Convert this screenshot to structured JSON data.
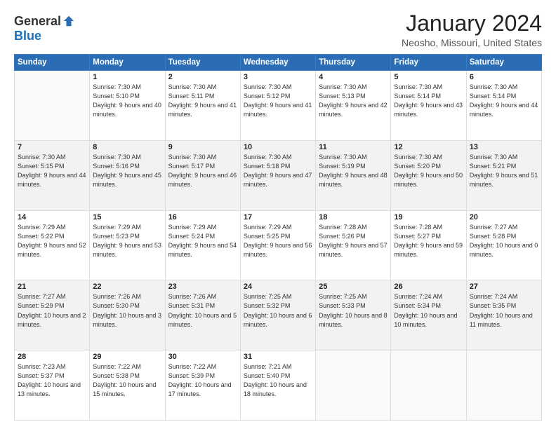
{
  "header": {
    "logo": {
      "general": "General",
      "blue": "Blue"
    },
    "title": "January 2024",
    "location": "Neosho, Missouri, United States"
  },
  "weekdays": [
    "Sunday",
    "Monday",
    "Tuesday",
    "Wednesday",
    "Thursday",
    "Friday",
    "Saturday"
  ],
  "weeks": [
    [
      {
        "day": "",
        "sunrise": "",
        "sunset": "",
        "daylight": ""
      },
      {
        "day": "1",
        "sunrise": "Sunrise: 7:30 AM",
        "sunset": "Sunset: 5:10 PM",
        "daylight": "Daylight: 9 hours and 40 minutes."
      },
      {
        "day": "2",
        "sunrise": "Sunrise: 7:30 AM",
        "sunset": "Sunset: 5:11 PM",
        "daylight": "Daylight: 9 hours and 41 minutes."
      },
      {
        "day": "3",
        "sunrise": "Sunrise: 7:30 AM",
        "sunset": "Sunset: 5:12 PM",
        "daylight": "Daylight: 9 hours and 41 minutes."
      },
      {
        "day": "4",
        "sunrise": "Sunrise: 7:30 AM",
        "sunset": "Sunset: 5:13 PM",
        "daylight": "Daylight: 9 hours and 42 minutes."
      },
      {
        "day": "5",
        "sunrise": "Sunrise: 7:30 AM",
        "sunset": "Sunset: 5:14 PM",
        "daylight": "Daylight: 9 hours and 43 minutes."
      },
      {
        "day": "6",
        "sunrise": "Sunrise: 7:30 AM",
        "sunset": "Sunset: 5:14 PM",
        "daylight": "Daylight: 9 hours and 44 minutes."
      }
    ],
    [
      {
        "day": "7",
        "sunrise": "Sunrise: 7:30 AM",
        "sunset": "Sunset: 5:15 PM",
        "daylight": "Daylight: 9 hours and 44 minutes."
      },
      {
        "day": "8",
        "sunrise": "Sunrise: 7:30 AM",
        "sunset": "Sunset: 5:16 PM",
        "daylight": "Daylight: 9 hours and 45 minutes."
      },
      {
        "day": "9",
        "sunrise": "Sunrise: 7:30 AM",
        "sunset": "Sunset: 5:17 PM",
        "daylight": "Daylight: 9 hours and 46 minutes."
      },
      {
        "day": "10",
        "sunrise": "Sunrise: 7:30 AM",
        "sunset": "Sunset: 5:18 PM",
        "daylight": "Daylight: 9 hours and 47 minutes."
      },
      {
        "day": "11",
        "sunrise": "Sunrise: 7:30 AM",
        "sunset": "Sunset: 5:19 PM",
        "daylight": "Daylight: 9 hours and 48 minutes."
      },
      {
        "day": "12",
        "sunrise": "Sunrise: 7:30 AM",
        "sunset": "Sunset: 5:20 PM",
        "daylight": "Daylight: 9 hours and 50 minutes."
      },
      {
        "day": "13",
        "sunrise": "Sunrise: 7:30 AM",
        "sunset": "Sunset: 5:21 PM",
        "daylight": "Daylight: 9 hours and 51 minutes."
      }
    ],
    [
      {
        "day": "14",
        "sunrise": "Sunrise: 7:29 AM",
        "sunset": "Sunset: 5:22 PM",
        "daylight": "Daylight: 9 hours and 52 minutes."
      },
      {
        "day": "15",
        "sunrise": "Sunrise: 7:29 AM",
        "sunset": "Sunset: 5:23 PM",
        "daylight": "Daylight: 9 hours and 53 minutes."
      },
      {
        "day": "16",
        "sunrise": "Sunrise: 7:29 AM",
        "sunset": "Sunset: 5:24 PM",
        "daylight": "Daylight: 9 hours and 54 minutes."
      },
      {
        "day": "17",
        "sunrise": "Sunrise: 7:29 AM",
        "sunset": "Sunset: 5:25 PM",
        "daylight": "Daylight: 9 hours and 56 minutes."
      },
      {
        "day": "18",
        "sunrise": "Sunrise: 7:28 AM",
        "sunset": "Sunset: 5:26 PM",
        "daylight": "Daylight: 9 hours and 57 minutes."
      },
      {
        "day": "19",
        "sunrise": "Sunrise: 7:28 AM",
        "sunset": "Sunset: 5:27 PM",
        "daylight": "Daylight: 9 hours and 59 minutes."
      },
      {
        "day": "20",
        "sunrise": "Sunrise: 7:27 AM",
        "sunset": "Sunset: 5:28 PM",
        "daylight": "Daylight: 10 hours and 0 minutes."
      }
    ],
    [
      {
        "day": "21",
        "sunrise": "Sunrise: 7:27 AM",
        "sunset": "Sunset: 5:29 PM",
        "daylight": "Daylight: 10 hours and 2 minutes."
      },
      {
        "day": "22",
        "sunrise": "Sunrise: 7:26 AM",
        "sunset": "Sunset: 5:30 PM",
        "daylight": "Daylight: 10 hours and 3 minutes."
      },
      {
        "day": "23",
        "sunrise": "Sunrise: 7:26 AM",
        "sunset": "Sunset: 5:31 PM",
        "daylight": "Daylight: 10 hours and 5 minutes."
      },
      {
        "day": "24",
        "sunrise": "Sunrise: 7:25 AM",
        "sunset": "Sunset: 5:32 PM",
        "daylight": "Daylight: 10 hours and 6 minutes."
      },
      {
        "day": "25",
        "sunrise": "Sunrise: 7:25 AM",
        "sunset": "Sunset: 5:33 PM",
        "daylight": "Daylight: 10 hours and 8 minutes."
      },
      {
        "day": "26",
        "sunrise": "Sunrise: 7:24 AM",
        "sunset": "Sunset: 5:34 PM",
        "daylight": "Daylight: 10 hours and 10 minutes."
      },
      {
        "day": "27",
        "sunrise": "Sunrise: 7:24 AM",
        "sunset": "Sunset: 5:35 PM",
        "daylight": "Daylight: 10 hours and 11 minutes."
      }
    ],
    [
      {
        "day": "28",
        "sunrise": "Sunrise: 7:23 AM",
        "sunset": "Sunset: 5:37 PM",
        "daylight": "Daylight: 10 hours and 13 minutes."
      },
      {
        "day": "29",
        "sunrise": "Sunrise: 7:22 AM",
        "sunset": "Sunset: 5:38 PM",
        "daylight": "Daylight: 10 hours and 15 minutes."
      },
      {
        "day": "30",
        "sunrise": "Sunrise: 7:22 AM",
        "sunset": "Sunset: 5:39 PM",
        "daylight": "Daylight: 10 hours and 17 minutes."
      },
      {
        "day": "31",
        "sunrise": "Sunrise: 7:21 AM",
        "sunset": "Sunset: 5:40 PM",
        "daylight": "Daylight: 10 hours and 18 minutes."
      },
      {
        "day": "",
        "sunrise": "",
        "sunset": "",
        "daylight": ""
      },
      {
        "day": "",
        "sunrise": "",
        "sunset": "",
        "daylight": ""
      },
      {
        "day": "",
        "sunrise": "",
        "sunset": "",
        "daylight": ""
      }
    ]
  ]
}
